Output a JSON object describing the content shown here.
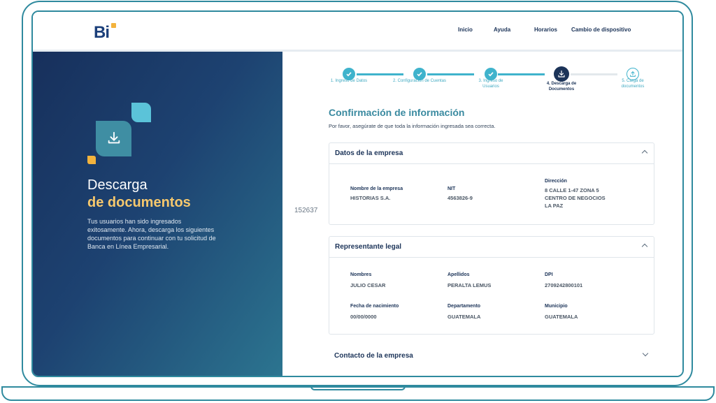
{
  "nav": {
    "items": [
      "Inicio",
      "Ayuda",
      "Horarios",
      "Cambio de dispositivo"
    ]
  },
  "logo": {
    "text": "Bi"
  },
  "left": {
    "title_line1": "Descarga",
    "title_line2": "de documentos",
    "description": "Tus usuarios han sido ingresados exitosamente. Ahora, descarga los siguientes documentos para continuar con tu solicitud de Banca en Línea Empresarial."
  },
  "stray_number": "152637",
  "stepper": {
    "steps": [
      {
        "label": "1. Ingreso de Datos",
        "state": "done"
      },
      {
        "label": "2. Configuración de Cuentas",
        "state": "done"
      },
      {
        "label": "3. Ingreso de Usuarios",
        "state": "done"
      },
      {
        "label": "4. Descarga de Documentos",
        "state": "current"
      },
      {
        "label": "5. Carga de documentos",
        "state": "pending"
      }
    ]
  },
  "header": {
    "title": "Confirmación de información",
    "subtitle": "Por favor, asegúrate de que toda la información ingresada sea correcta."
  },
  "empresa": {
    "title": "Datos de la empresa",
    "nombre_label": "Nombre de la empresa",
    "nombre_value": "HISTORIAS S.A.",
    "nit_label": "NIT",
    "nit_value": "4563826-9",
    "direccion_label": "Dirección",
    "direccion_value": "8 CALLE 1-47 ZONA 5\nCENTRO DE NEGOCIOS\nLA PAZ"
  },
  "representante": {
    "title": "Representante legal",
    "nombres_label": "Nombres",
    "nombres_value": "JULIO CESAR",
    "apellidos_label": "Apellidos",
    "apellidos_value": "PERALTA LEMUS",
    "dpi_label": "DPI",
    "dpi_value": "2709242800101",
    "fecha_label": "Fecha de nacimiento",
    "fecha_value": "00/00/0000",
    "departamento_label": "Departamento",
    "departamento_value": "GUATEMALA",
    "municipio_label": "Municipio",
    "municipio_value": "GUATEMALA"
  },
  "contacto": {
    "title": "Contacto de la empresa"
  },
  "colors": {
    "accent": "#3fb3cc",
    "navy": "#1b3358",
    "gold": "#f6c86d"
  }
}
